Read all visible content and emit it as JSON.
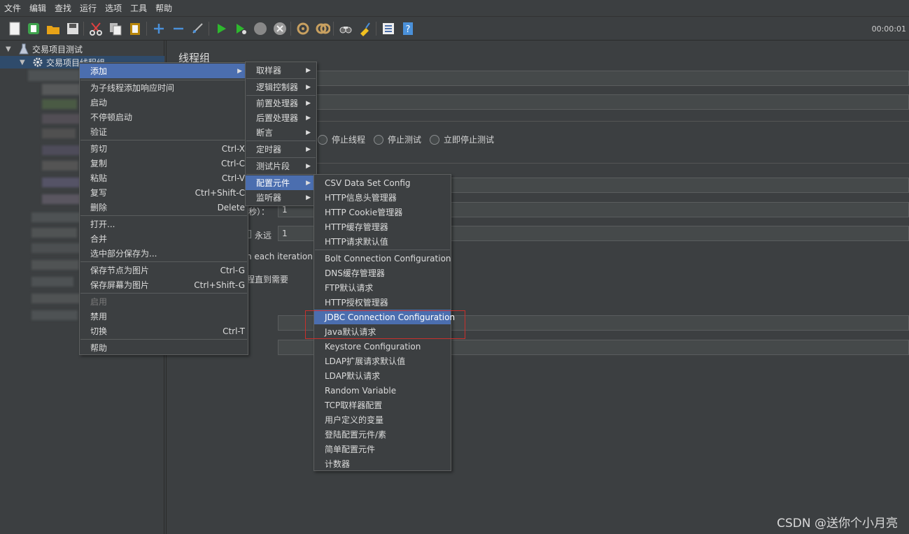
{
  "menubar": [
    "文件",
    "编辑",
    "查找",
    "运行",
    "选项",
    "工具",
    "帮助"
  ],
  "toolbar": {
    "icons": [
      "new-icon",
      "templates-icon",
      "open-icon",
      "save-icon",
      "cut-icon",
      "copy-icon",
      "paste-icon",
      "expand-icon",
      "collapse-icon",
      "toggle-icon",
      "start-icon",
      "start-no-pause-icon",
      "stop-icon",
      "shutdown-icon",
      "clear-icon",
      "clear-all-icon",
      "search-icon",
      "reset-search-icon",
      "function-helper-icon",
      "help-icon"
    ],
    "timer": "00:00:01"
  },
  "tree": {
    "root": "交易项目测试",
    "child": "交易项目线程组"
  },
  "panel": {
    "title": "线程组",
    "radio_stop_thread": "停止线程",
    "radio_stop_test": "停止测试",
    "radio_stop_now": "立即停止测试",
    "ramp_label_fragment": "秒）：",
    "ramp_value": "1",
    "forever_label": "永远",
    "loop_value": "1",
    "same_user_fragment": "n each iteration",
    "delay_fragment": "程直到需要"
  },
  "context_menu": {
    "add": "添加",
    "add_response_time": "为子线程添加响应时间",
    "start": "启动",
    "start_no_pause": "不停顿启动",
    "validate": "验证",
    "cut": "剪切",
    "cut_sc": "Ctrl-X",
    "copy": "复制",
    "copy_sc": "Ctrl-C",
    "paste": "粘贴",
    "paste_sc": "Ctrl-V",
    "duplicate": "复写",
    "duplicate_sc": "Ctrl+Shift-C",
    "delete": "删除",
    "delete_sc": "Delete",
    "open": "打开...",
    "merge": "合并",
    "save_selection": "选中部分保存为...",
    "save_node_image": "保存节点为图片",
    "save_node_image_sc": "Ctrl-G",
    "save_screen_image": "保存屏幕为图片",
    "save_screen_image_sc": "Ctrl+Shift-G",
    "enable": "启用",
    "disable": "禁用",
    "toggle": "切换",
    "toggle_sc": "Ctrl-T",
    "help": "帮助"
  },
  "add_submenu": [
    "取样器",
    "逻辑控制器",
    "前置处理器",
    "后置处理器",
    "断言",
    "定时器",
    "测试片段",
    "配置元件",
    "监听器"
  ],
  "config_submenu": [
    "CSV Data Set Config",
    "HTTP信息头管理器",
    "HTTP Cookie管理器",
    "HTTP缓存管理器",
    "HTTP请求默认值",
    "Bolt Connection Configuration",
    "DNS缓存管理器",
    "FTP默认请求",
    "HTTP授权管理器",
    "JDBC Connection Configuration",
    "Java默认请求",
    "Keystore Configuration",
    "LDAP扩展请求默认值",
    "LDAP默认请求",
    "Random Variable",
    "TCP取样器配置",
    "用户定义的变量",
    "登陆配置元件/素",
    "简单配置元件",
    "计数器"
  ],
  "watermark": "CSDN @送你个小月亮",
  "colors": {
    "highlight": "#4b6eaf",
    "background": "#3c3f41",
    "annotation": "#c9302c"
  }
}
